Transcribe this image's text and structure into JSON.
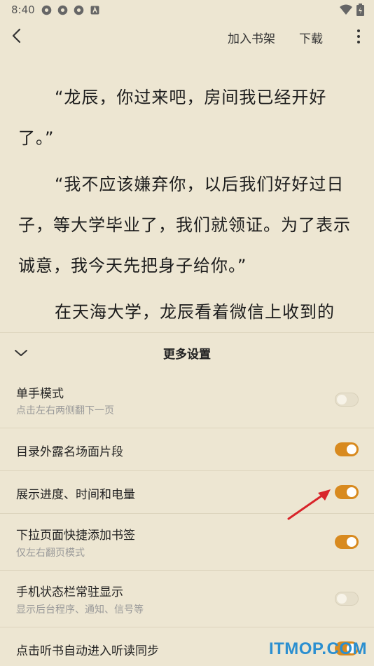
{
  "status_bar": {
    "time": "8:40"
  },
  "top_bar": {
    "add_shelf_label": "加入书架",
    "download_label": "下载"
  },
  "reader": {
    "paragraphs": [
      "“龙辰，你过来吧，房间我已经开好了。”",
      "“我不应该嫌弃你，以后我们好好过日子，等大学毕业了，我们就领证。为了表示诚意，我今天先把身子给你。”",
      "在天海大学，龙辰看着微信上收到的"
    ]
  },
  "settings_panel": {
    "title": "更多设置",
    "rows": [
      {
        "title": "单手模式",
        "subtitle": "点击左右两侧翻下一页",
        "enabled": false
      },
      {
        "title": "目录外露名场面片段",
        "subtitle": "",
        "enabled": true
      },
      {
        "title": "展示进度、时间和电量",
        "subtitle": "",
        "enabled": true
      },
      {
        "title": "下拉页面快捷添加书签",
        "subtitle": "仅左右翻页模式",
        "enabled": true
      },
      {
        "title": "手机状态栏常驻显示",
        "subtitle": "显示后台程序、通知、信号等",
        "enabled": false
      },
      {
        "title": "点击听书自动进入听读同步",
        "subtitle": "",
        "enabled": true
      }
    ]
  },
  "watermark": "ITMOP.COM",
  "colors": {
    "toggle_on": "#d88a1f",
    "background": "#ede6d2",
    "arrow": "#d8242a"
  }
}
